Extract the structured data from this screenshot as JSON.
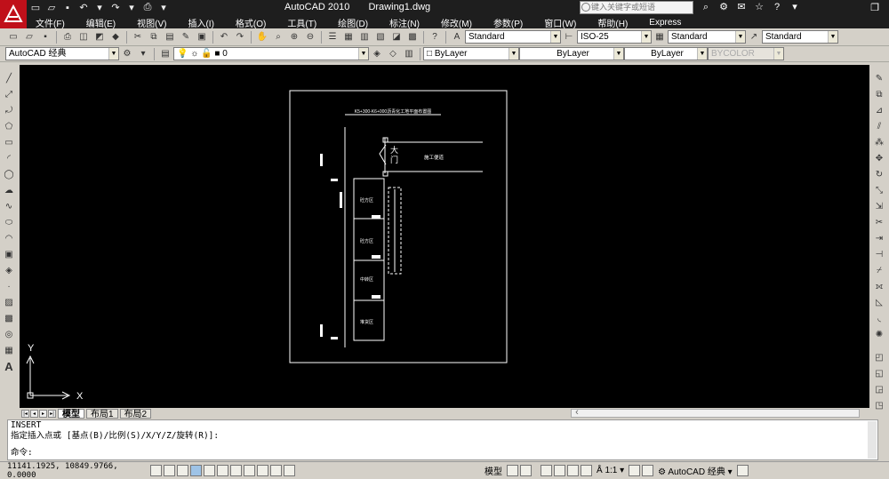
{
  "titlebar": {
    "app_name": "AutoCAD 2010",
    "file_name": "Drawing1.dwg",
    "search_placeholder": "键入关键字或短语"
  },
  "menu": [
    "文件(F)",
    "编辑(E)",
    "视图(V)",
    "插入(I)",
    "格式(O)",
    "工具(T)",
    "绘图(D)",
    "标注(N)",
    "修改(M)",
    "参数(P)",
    "窗口(W)",
    "帮助(H)",
    "Express"
  ],
  "styles": {
    "text_style": "Standard",
    "dim_style": "ISO-25",
    "table_style": "Standard",
    "multileader_style": "Standard"
  },
  "workspace": "AutoCAD 经典",
  "layer": {
    "name": "0"
  },
  "properties": {
    "color": "ByLayer",
    "linetype": "ByLayer",
    "lineweight": "ByLayer",
    "plotstyle": "BYCOLOR"
  },
  "drawing": {
    "title": "K5+300-K6+000沥青化工地平面布置图",
    "gate": "大门",
    "road": "施工便道",
    "zones": [
      "砼方区",
      "砼方区",
      "中转区",
      "堆货区"
    ],
    "ucs_x": "X",
    "ucs_y": "Y"
  },
  "layout_tabs": [
    "模型",
    "布局1",
    "布局2"
  ],
  "command": {
    "history_1": "INSERT",
    "history_2": "指定插入点或 [基点(B)/比例(S)/X/Y/Z/旋转(R)]:",
    "prompt": "命令:"
  },
  "status": {
    "coordinates": "11141.1925, 10849.9766, 0.0000",
    "model_label": "模型",
    "annotation_scale": "1:1",
    "workspace_label": "AutoCAD 经典"
  },
  "colors": {
    "canvas": "#000000",
    "logo": "#c0101a",
    "drawing_lines": "#ffffff"
  }
}
